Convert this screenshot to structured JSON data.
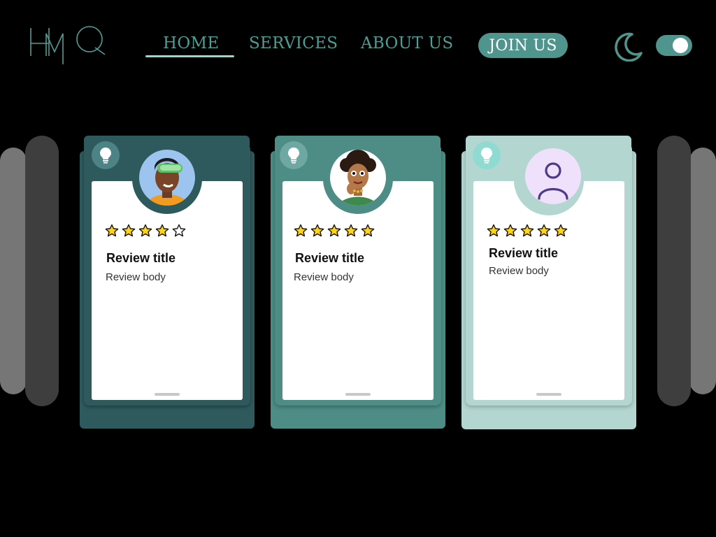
{
  "header": {
    "logo_text": "HMQ",
    "nav": [
      {
        "label": "HOME"
      },
      {
        "label": "SERVICES"
      },
      {
        "label": "ABOUT US"
      }
    ],
    "join_label": "JOIN US",
    "dark_mode_icon": "moon-icon",
    "theme_toggle_on": true
  },
  "reviews": [
    {
      "title": "Review title",
      "body": "Review body",
      "rating": 4,
      "avatar": "avatar-vr-headset-person",
      "accent": "#2f5f63"
    },
    {
      "title": "Review title",
      "body": "Review body",
      "rating": 5,
      "avatar": "avatar-curly-hair-person",
      "accent": "#4c8e87"
    },
    {
      "title": "Review title",
      "body": "Review body",
      "rating": 5,
      "avatar": "avatar-placeholder-person",
      "accent": "#b4d8d3"
    }
  ],
  "colors": {
    "teal_dark": "#2f5f63",
    "teal_mid": "#4f958d",
    "teal_light": "#b4d8d3",
    "star_fill": "#ffd21c",
    "avatar_placeholder_bg": "#efe1fb",
    "avatar_placeholder_icon": "#4d3b8a"
  }
}
